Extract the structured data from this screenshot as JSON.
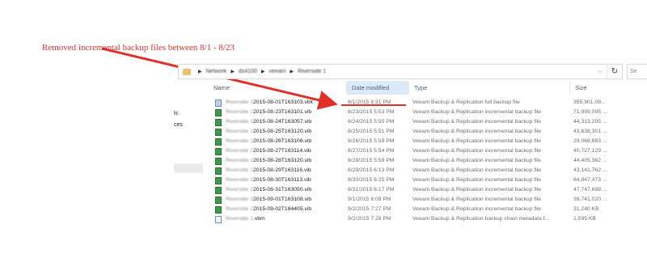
{
  "annotation": {
    "text": "Removed incremental backup files between 8/1 - 8/23",
    "color": "#e0302a"
  },
  "addressbar": {
    "crumbs": [
      "Network",
      "ds4100",
      "veeam",
      "Riverside 1"
    ],
    "refresh_icon": "refresh-icon"
  },
  "search": {
    "placeholder": "Se"
  },
  "left_pane": {
    "fragments": [
      "ls",
      "ces"
    ]
  },
  "columns": {
    "name": "Name",
    "date": "Date modified",
    "type": "Type",
    "size": "Size"
  },
  "files": [
    {
      "prefix": "Riverside 1",
      "name": "2015-08-01T163103.vbk",
      "date": "8/1/2015 6:31 PM",
      "type": "Veeam Backup & Replication full backup file",
      "size": "355,901,08...",
      "icon": "vbk"
    },
    {
      "prefix": "Riverside 1",
      "name": "2015-08-23T163101.vib",
      "date": "8/23/2015 5:53 PM",
      "type": "Veeam Backup & Replication incremental backup file",
      "size": "71,999,095 ...",
      "icon": "vib"
    },
    {
      "prefix": "Riverside 1",
      "name": "2015-08-24T163057.vib",
      "date": "8/24/2015 5:55 PM",
      "type": "Veeam Backup & Replication incremental backup file",
      "size": "44,313,205 ...",
      "icon": "vib"
    },
    {
      "prefix": "Riverside 1",
      "name": "2015-08-25T163120.vib",
      "date": "8/25/2015 5:51 PM",
      "type": "Veeam Backup & Replication incremental backup file",
      "size": "43,638,301 ...",
      "icon": "vib"
    },
    {
      "prefix": "Riverside 1",
      "name": "2015-08-26T163106.vib",
      "date": "8/26/2015 5:59 PM",
      "type": "Veeam Backup & Replication incremental backup file",
      "size": "29,068,883 ...",
      "icon": "vib"
    },
    {
      "prefix": "Riverside 1",
      "name": "2015-08-27T163114.vib",
      "date": "8/27/2015 5:54 PM",
      "type": "Veeam Backup & Replication incremental backup file",
      "size": "40,727,129 ...",
      "icon": "vib"
    },
    {
      "prefix": "Riverside 1",
      "name": "2015-08-28T163120.vib",
      "date": "8/28/2015 5:59 PM",
      "type": "Veeam Backup & Replication incremental backup file",
      "size": "44,405,362 ...",
      "icon": "vib"
    },
    {
      "prefix": "Riverside 1",
      "name": "2015-08-29T163116.vib",
      "date": "8/29/2015 6:13 PM",
      "type": "Veeam Backup & Replication incremental backup file",
      "size": "43,141,762 ...",
      "icon": "vib"
    },
    {
      "prefix": "Riverside 1",
      "name": "2015-08-30T163113.vib",
      "date": "8/30/2015 6:25 PM",
      "type": "Veeam Backup & Replication incremental backup file",
      "size": "64,847,473 ...",
      "icon": "vib"
    },
    {
      "prefix": "Riverside 1",
      "name": "2015-08-31T163050.vib",
      "date": "8/31/2015 6:17 PM",
      "type": "Veeam Backup & Replication incremental backup file",
      "size": "47,747,698 ...",
      "icon": "vib"
    },
    {
      "prefix": "Riverside 1",
      "name": "2015-09-01T163108.vib",
      "date": "9/1/2015 6:08 PM",
      "type": "Veeam Backup & Replication incremental backup file",
      "size": "39,741,020 ...",
      "icon": "vib"
    },
    {
      "prefix": "Riverside 1",
      "name": "2015-09-02T184405.vib",
      "date": "9/2/2015 7:27 PM",
      "type": "Veeam Backup & Replication incremental backup file",
      "size": "31,240 KB",
      "icon": "vib"
    },
    {
      "prefix": "Riverside 1",
      "name": ".vbm",
      "date": "9/2/2015 7:28 PM",
      "type": "Veeam Backup & Replication backup chain metadata f...",
      "size": "1,595 KB",
      "icon": "vbm"
    }
  ]
}
